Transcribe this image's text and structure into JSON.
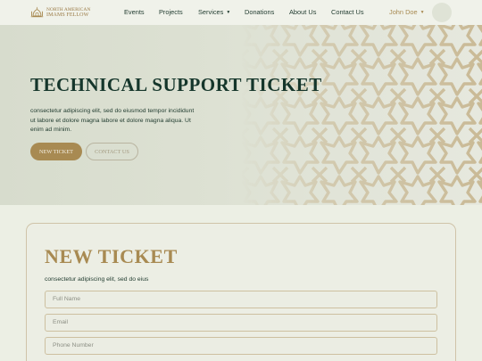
{
  "brand": {
    "line1": "NORTH AMERICAN",
    "line2": "IMAMS FELLOW",
    "accent": "#a88a52"
  },
  "nav": {
    "items": [
      {
        "label": "Events"
      },
      {
        "label": "Projects"
      },
      {
        "label": "Services",
        "has_dropdown": true
      },
      {
        "label": "Donations"
      },
      {
        "label": "About Us"
      },
      {
        "label": "Contact Us"
      }
    ],
    "user_name": "John Doe"
  },
  "hero": {
    "title": "TECHNICAL SUPPORT TICKET",
    "description": "consectetur adipiscing elit, sed do eiusmod tempor incididunt ut labore et dolore magna labore et dolore magna aliqua. Ut enim ad minim.",
    "primary_button": "NEW TICKET",
    "secondary_button": "CONTACT US"
  },
  "form": {
    "title": "NEW TICKET",
    "subtitle": "consectetur adipiscing elit, sed do eius",
    "fields": [
      {
        "placeholder": "Full Name"
      },
      {
        "placeholder": "Email"
      },
      {
        "placeholder": "Phone Number"
      }
    ]
  },
  "colors": {
    "dark_green": "#15362b",
    "gold": "#a88a52",
    "background": "#ecefe4"
  }
}
